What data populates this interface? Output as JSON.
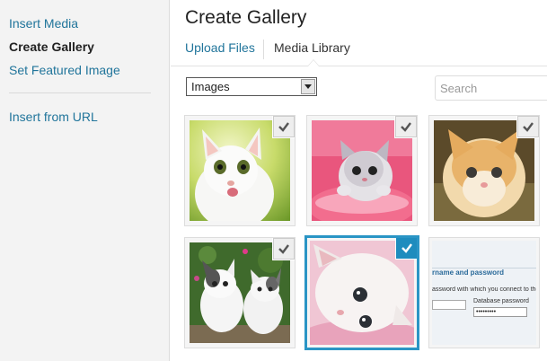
{
  "sidebar": {
    "items": [
      {
        "label": "Insert Media"
      },
      {
        "label": "Create Gallery"
      },
      {
        "label": "Set Featured Image"
      },
      {
        "label": "Insert from URL"
      }
    ]
  },
  "header": {
    "title": "Create Gallery"
  },
  "tabs": [
    {
      "label": "Upload Files"
    },
    {
      "label": "Media Library"
    }
  ],
  "filter": {
    "selected": "Images"
  },
  "search": {
    "placeholder": "Search"
  },
  "attachments": [
    {
      "name": "white-kitten",
      "selected": true,
      "focused": false
    },
    {
      "name": "kitten-in-pink-bucket",
      "selected": true,
      "focused": false
    },
    {
      "name": "orange-kitten",
      "selected": true,
      "focused": false
    },
    {
      "name": "two-kittens-outdoors",
      "selected": true,
      "focused": false
    },
    {
      "name": "kitten-lying-down",
      "selected": true,
      "focused": true
    },
    {
      "name": "login-screenshot",
      "selected": false,
      "focused": false
    }
  ],
  "screenshot_text": {
    "heading": "rname and password",
    "line": "assword with which you connect to the d",
    "db_label": "Database password",
    "password_mask": "•••••••••"
  },
  "colors": {
    "link": "#21759b",
    "selected_border": "#2a95c5",
    "check_active": "#1e8cbe"
  }
}
